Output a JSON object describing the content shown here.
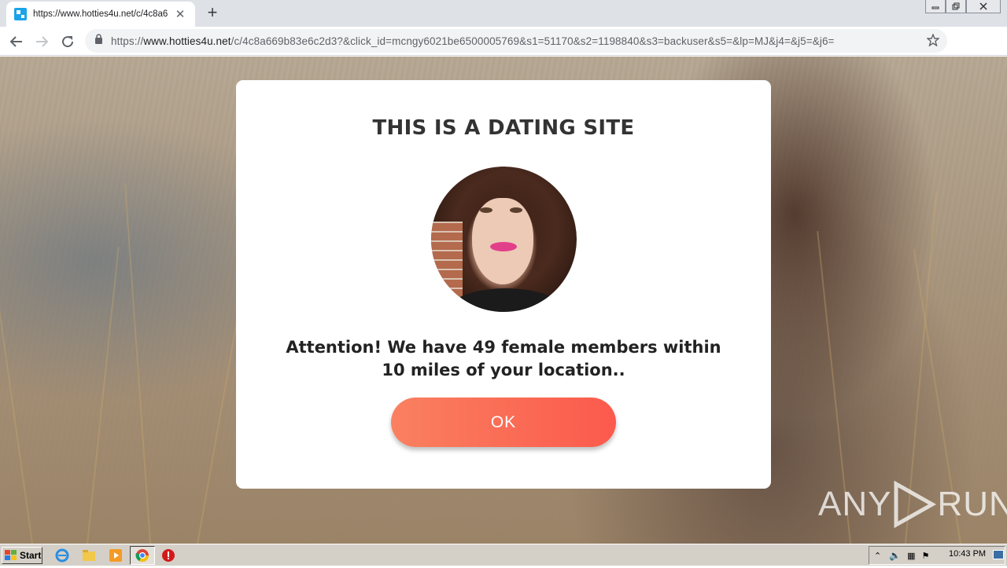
{
  "browser": {
    "tab_title": "https://www.hotties4u.net/c/4c8a6",
    "url_scheme": "https://",
    "url_host": "www.hotties4u.net",
    "url_path": "/c/4c8a669b83e6c2d3?&click_id=mcngy6021be6500005769&s1=51170&s2=1198840&s3=backuser&s5=&lp=MJ&j4=&j5=&j6="
  },
  "modal": {
    "title": "THIS IS A DATING SITE",
    "message": "Attention! We have 49 female members within 10 miles of your location..",
    "ok_label": "OK"
  },
  "watermark": {
    "left": "ANY",
    "right": "RUN"
  },
  "taskbar": {
    "start_label": "Start",
    "clock": "10:43 PM"
  },
  "colors": {
    "ok_gradient_start": "#fa8060",
    "ok_gradient_end": "#fb5a4c",
    "title_text": "#333333"
  },
  "icons": [
    "tab-favicon-icon",
    "close-tab-icon",
    "new-tab-icon",
    "back-icon",
    "forward-icon",
    "reload-icon",
    "lock-icon",
    "bookmark-star-icon",
    "profile-icon",
    "menu-icon",
    "ie-icon",
    "explorer-icon",
    "media-player-icon",
    "chrome-icon",
    "stop-icon"
  ]
}
